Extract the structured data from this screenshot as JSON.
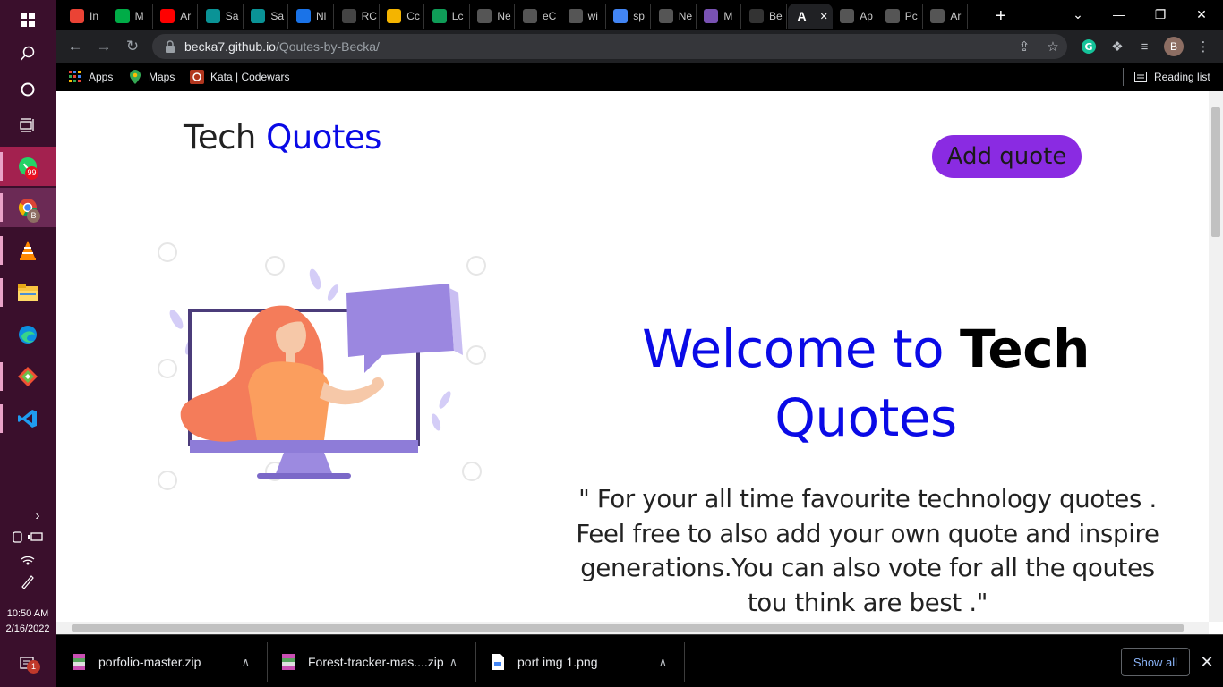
{
  "browser": {
    "tabs": [
      {
        "label": "In",
        "icon": "gmail-icon",
        "color": "#ea4335"
      },
      {
        "label": "M",
        "icon": "meet-icon",
        "color": "#00ac47"
      },
      {
        "label": "Ar",
        "icon": "youtube-icon",
        "color": "#ff0000"
      },
      {
        "label": "Sa",
        "icon": "freecodecamp-icon",
        "color": "#0a9396"
      },
      {
        "label": "Sa",
        "icon": "freecodecamp-icon",
        "color": "#0a9396"
      },
      {
        "label": "Nl",
        "icon": "page-icon",
        "color": "#1a73e8"
      },
      {
        "label": "RC",
        "icon": "rc-icon",
        "color": "#444444"
      },
      {
        "label": "Cc",
        "icon": "colorful-icon",
        "color": "#f4b400"
      },
      {
        "label": "Lc",
        "icon": "w-icon",
        "color": "#0f9d58"
      },
      {
        "label": "Ne",
        "icon": "globe-icon",
        "color": "#555555"
      },
      {
        "label": "eC",
        "icon": "globe-icon",
        "color": "#555555"
      },
      {
        "label": "wi",
        "icon": "globe-icon",
        "color": "#555555"
      },
      {
        "label": "sp",
        "icon": "google-icon",
        "color": "#4285f4"
      },
      {
        "label": "Ne",
        "icon": "globe-icon",
        "color": "#555555"
      },
      {
        "label": "M",
        "icon": "bootstrap-icon",
        "color": "#7952b3"
      },
      {
        "label": "Be",
        "icon": "github-icon",
        "color": "#333333"
      },
      {
        "label": "",
        "icon": "a-icon",
        "color": "#ffffff",
        "active": true
      },
      {
        "label": "Ap",
        "icon": "globe-icon",
        "color": "#555555"
      },
      {
        "label": "Pc",
        "icon": "globe-icon",
        "color": "#555555"
      },
      {
        "label": "Ar",
        "icon": "globe-icon",
        "color": "#555555"
      }
    ],
    "new_tab": "+",
    "url_host": "becka7.github.io",
    "url_path": "/Qoutes-by-Becka/",
    "profile_initial": "B",
    "bookmarks": [
      {
        "label": "Apps",
        "icon": "apps-grid-icon"
      },
      {
        "label": "Maps",
        "icon": "maps-pin-icon"
      },
      {
        "label": "Kata | Codewars",
        "icon": "codewars-icon"
      }
    ],
    "reading_list": "Reading list"
  },
  "page": {
    "brand_part1": "Tech ",
    "brand_part2": "Quotes",
    "add_button": "Add quote",
    "welcome_part1": "Welcome to ",
    "welcome_part2": "Tech",
    "welcome_part3": "Quotes",
    "tagline": "\" For your all time favourite technology quotes . Feel free to also add your own quote and inspire generations.You can also vote for all the qoutes tou think are best .\""
  },
  "downloads": {
    "items": [
      {
        "name": "porfolio-master.zip",
        "icon": "zip-file-icon"
      },
      {
        "name": "Forest-tracker-mas....zip",
        "icon": "zip-file-icon"
      },
      {
        "name": "port img 1.png",
        "icon": "image-file-icon"
      }
    ],
    "show_all": "Show all"
  },
  "taskbar": {
    "whatsapp_badge": "99",
    "chrome_badge": "B",
    "notification_badge": "1",
    "time": "10:50 AM",
    "date": "2/16/2022"
  },
  "colors": {
    "accent_blue": "#0a0ae6",
    "button_purple": "#8a2be2",
    "taskbar_bg": "#3a0f2c"
  }
}
